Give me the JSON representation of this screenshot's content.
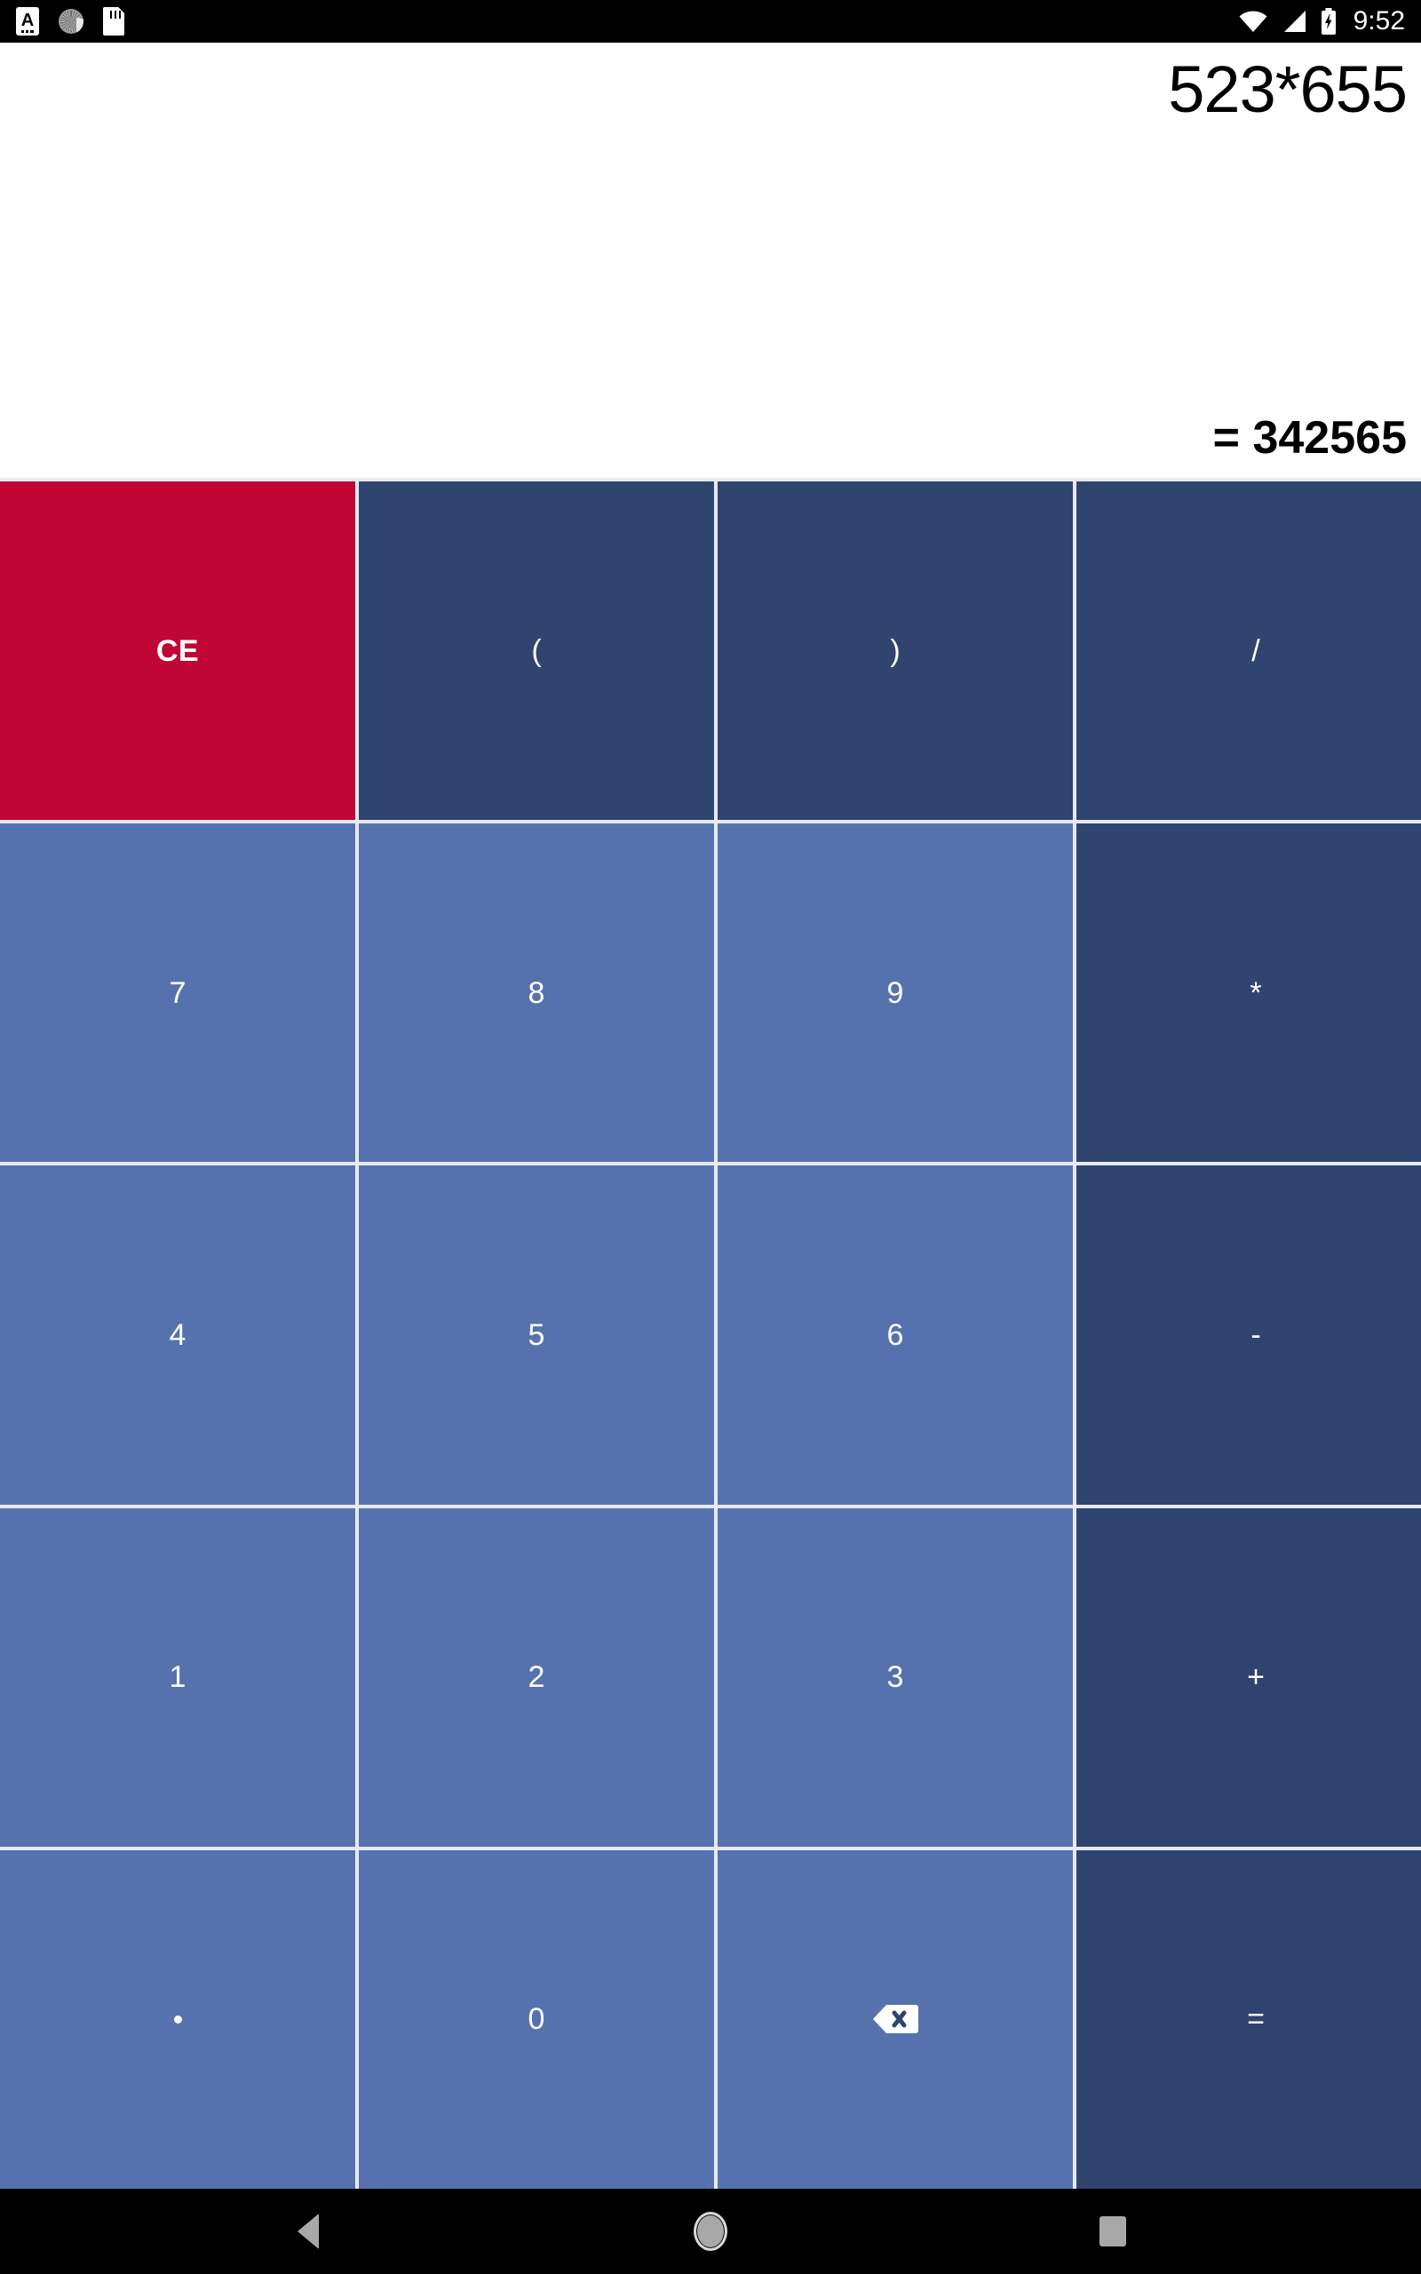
{
  "status_bar": {
    "left_icons": [
      {
        "name": "ime-keyboard-icon",
        "label": "A"
      },
      {
        "name": "sync-progress-icon",
        "label": ""
      },
      {
        "name": "sd-card-icon",
        "label": ""
      }
    ],
    "right_icons": [
      {
        "name": "wifi-icon",
        "label": ""
      },
      {
        "name": "cellular-signal-icon",
        "label": ""
      },
      {
        "name": "battery-charging-icon",
        "label": ""
      }
    ],
    "clock": "9:52"
  },
  "display": {
    "expression": "523*655",
    "result": "= 342565"
  },
  "keypad": {
    "keys": [
      {
        "label": "CE",
        "name": "key-clear-entry",
        "type": "clear",
        "col": 1
      },
      {
        "label": "(",
        "name": "key-open-paren",
        "type": "op",
        "col": 2
      },
      {
        "label": ")",
        "name": "key-close-paren",
        "type": "op",
        "col": 3
      },
      {
        "label": "/",
        "name": "key-divide",
        "type": "op",
        "col": 4
      },
      {
        "label": "7",
        "name": "key-7",
        "type": "num",
        "col": 1
      },
      {
        "label": "8",
        "name": "key-8",
        "type": "num",
        "col": 2
      },
      {
        "label": "9",
        "name": "key-9",
        "type": "num",
        "col": 3
      },
      {
        "label": "*",
        "name": "key-multiply",
        "type": "op",
        "col": 4
      },
      {
        "label": "4",
        "name": "key-4",
        "type": "num",
        "col": 1
      },
      {
        "label": "5",
        "name": "key-5",
        "type": "num",
        "col": 2
      },
      {
        "label": "6",
        "name": "key-6",
        "type": "num",
        "col": 3
      },
      {
        "label": "-",
        "name": "key-minus",
        "type": "op",
        "col": 4
      },
      {
        "label": "1",
        "name": "key-1",
        "type": "num",
        "col": 1
      },
      {
        "label": "2",
        "name": "key-2",
        "type": "num",
        "col": 2
      },
      {
        "label": "3",
        "name": "key-3",
        "type": "num",
        "col": 3
      },
      {
        "label": "+",
        "name": "key-plus",
        "type": "op",
        "col": 4
      },
      {
        "label": ".",
        "name": "key-decimal",
        "type": "num",
        "col": 1,
        "glyph": "dot"
      },
      {
        "label": "0",
        "name": "key-0",
        "type": "num",
        "col": 2
      },
      {
        "label": "",
        "name": "key-backspace",
        "type": "num",
        "col": 3,
        "glyph": "backspace"
      },
      {
        "label": "=",
        "name": "key-equals",
        "type": "op",
        "col": 4
      }
    ]
  },
  "nav_bar": {
    "back_label": "Back",
    "home_label": "Home",
    "recents_label": "Recents"
  },
  "colors": {
    "number_key": "#5672ae",
    "operator_key": "#2f446e",
    "clear_key": "#bf0634",
    "key_divider": "#e7eaf4",
    "display_background": "#ffffff",
    "display_text": "#000000",
    "status_bar": "#000000",
    "nav_bar": "#000000"
  }
}
